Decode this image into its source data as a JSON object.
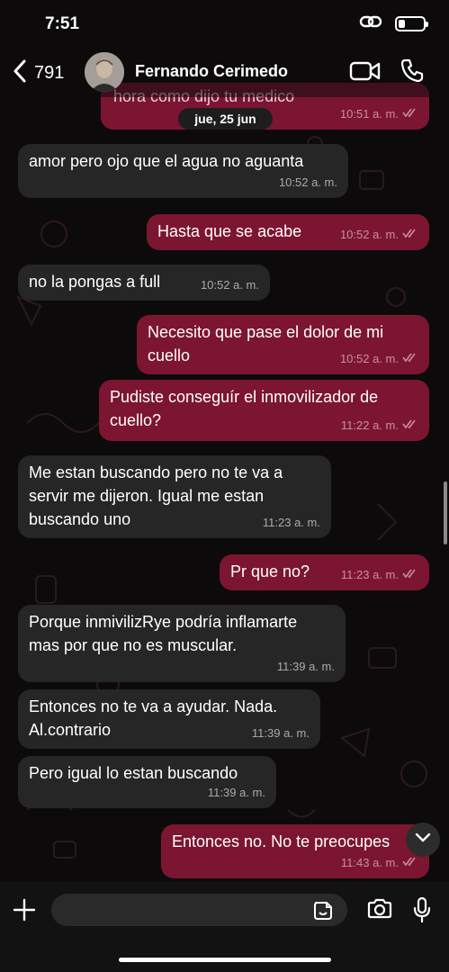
{
  "status_bar": {
    "time": "7:51",
    "battery_level": 0.25
  },
  "header": {
    "back_count": "791",
    "contact_name": "Fernando Cerimedo",
    "icons": [
      "chevron-left-icon",
      "video-call-icon",
      "phone-icon"
    ]
  },
  "date_chip": "jue, 25 jun",
  "partial_top_message": {
    "text": "hora como dijo tu medico",
    "time": "10:51 a. m."
  },
  "messages": [
    {
      "direction": "in",
      "text": "amor pero ojo que el agua no aguanta",
      "time": "10:52 a. m."
    },
    {
      "direction": "out",
      "text": "Hasta que se acabe",
      "time": "10:52 a. m."
    },
    {
      "direction": "in",
      "text": "no la pongas a full",
      "time": "10:52 a. m."
    },
    {
      "direction": "out",
      "text": "Necesito que pase el dolor de mi\ncuello",
      "time": "10:52 a. m."
    },
    {
      "direction": "out",
      "text": "Pudiste conseguír el inmovilizador de\ncuello?",
      "time": "11:22 a. m."
    },
    {
      "direction": "in",
      "text": "Me estan buscando pero no te va a\nservir me dijeron. Igual me estan\nbuscando uno",
      "time": "11:23 a. m."
    },
    {
      "direction": "out",
      "text": "Pr que no?",
      "time": "11:23 a. m."
    },
    {
      "direction": "in",
      "text": "Porque inmivilizRye podría inflamarte\nmas por que no es muscular.",
      "time": "11:39 a. m."
    },
    {
      "direction": "in",
      "text": "Entonces no te va a ayudar. Nada.\nAl.contrario",
      "time": "11:39 a. m."
    },
    {
      "direction": "in",
      "text": "Pero igual lo estan buscando",
      "time": "11:39 a. m."
    },
    {
      "direction": "out",
      "text": "Entonces no. No te preocupes",
      "time": "11:43 a. m."
    }
  ],
  "composer": {
    "placeholder": "",
    "icons": [
      "plus-icon",
      "sticker-icon",
      "camera-icon",
      "microphone-icon"
    ]
  },
  "colors": {
    "incoming_bubble": "#262626",
    "outgoing_bubble": "#7c1532",
    "background": "#0d0a0b"
  }
}
